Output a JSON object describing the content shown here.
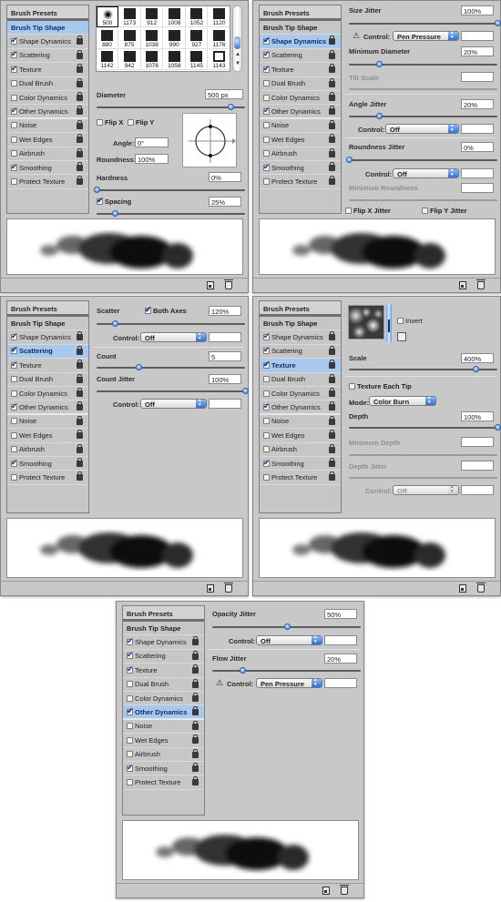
{
  "sidebar": {
    "presets": "Brush Presets",
    "tip_shape": "Brush Tip Shape",
    "items": [
      {
        "label": "Shape Dynamics",
        "checked": true
      },
      {
        "label": "Scattering",
        "checked": true
      },
      {
        "label": "Texture",
        "checked": true
      },
      {
        "label": "Dual Brush",
        "checked": false
      },
      {
        "label": "Color Dynamics",
        "checked": false
      },
      {
        "label": "Other Dynamics",
        "checked": true
      },
      {
        "label": "Noise",
        "checked": false
      },
      {
        "label": "Wet Edges",
        "checked": false
      },
      {
        "label": "Airbrush",
        "checked": false
      },
      {
        "label": "Smoothing",
        "checked": true
      },
      {
        "label": "Protect Texture",
        "checked": false
      }
    ]
  },
  "panels": [
    {
      "active_section": "Brush Tip Shape",
      "brush_tips": [
        "500",
        "1173",
        "912",
        "1008",
        "1052",
        "1120",
        "880",
        "875",
        "1038",
        "990",
        "927",
        "1176",
        "1142",
        "942",
        "1078",
        "1058",
        "1145",
        "1143"
      ],
      "selected_tip": "500",
      "diameter": {
        "label": "Diameter",
        "value": "500 px",
        "slider": 0.9
      },
      "flip_x": {
        "label": "Flip X",
        "checked": false
      },
      "flip_y": {
        "label": "Flip Y",
        "checked": false
      },
      "angle": {
        "label": "Angle:",
        "value": "0°"
      },
      "roundness": {
        "label": "Roundness:",
        "value": "100%"
      },
      "hardness": {
        "label": "Hardness",
        "value": "0%",
        "slider": 0.0
      },
      "spacing": {
        "label": "Spacing",
        "value": "25%",
        "checked": true,
        "slider": 0.12
      }
    },
    {
      "active_section": "Shape Dynamics",
      "size_jitter": {
        "label": "Size Jitter",
        "value": "100%",
        "slider": 1.0
      },
      "size_control": {
        "label": "Control:",
        "value": "Pen Pressure",
        "warning": true
      },
      "min_diameter": {
        "label": "Minimum Diameter",
        "value": "20%",
        "slider": 0.2
      },
      "tilt_scale": {
        "label": "Tilt Scale",
        "value": ""
      },
      "angle_jitter": {
        "label": "Angle Jitter",
        "value": "20%",
        "slider": 0.2
      },
      "angle_control": {
        "label": "Control:",
        "value": "Off"
      },
      "roundness_jitter": {
        "label": "Roundness Jitter",
        "value": "0%",
        "slider": 0.0
      },
      "roundness_control": {
        "label": "Control:",
        "value": "Off"
      },
      "min_roundness": {
        "label": "Minimum Roundness",
        "value": ""
      },
      "flip_x_jitter": {
        "label": "Flip X Jitter",
        "checked": false
      },
      "flip_y_jitter": {
        "label": "Flip Y Jitter",
        "checked": false
      }
    },
    {
      "active_section": "Scattering",
      "scatter": {
        "label": "Scatter",
        "value": "120%",
        "slider": 0.12
      },
      "both_axes": {
        "label": "Both Axes",
        "checked": true
      },
      "scatter_control": {
        "label": "Control:",
        "value": "Off"
      },
      "count": {
        "label": "Count",
        "value": "5",
        "slider": 0.28
      },
      "count_jitter": {
        "label": "Count Jitter",
        "value": "100%",
        "slider": 1.0
      },
      "count_control": {
        "label": "Control:",
        "value": "Off"
      }
    },
    {
      "active_section": "Texture",
      "invert": {
        "label": "Invert",
        "checked": false
      },
      "scale": {
        "label": "Scale",
        "value": "400%",
        "slider": 0.85
      },
      "texture_each_tip": {
        "label": "Texture Each Tip",
        "checked": false
      },
      "mode": {
        "label": "Mode:",
        "value": "Color Burn"
      },
      "depth": {
        "label": "Depth",
        "value": "100%",
        "slider": 1.0
      },
      "min_depth": {
        "label": "Minimum Depth",
        "value": ""
      },
      "depth_jitter": {
        "label": "Depth Jitter",
        "value": ""
      },
      "depth_control": {
        "label": "Control:",
        "value": "Off"
      }
    },
    {
      "active_section": "Other Dynamics",
      "opacity_jitter": {
        "label": "Opacity Jitter",
        "value": "50%",
        "slider": 0.5
      },
      "opacity_control": {
        "label": "Control:",
        "value": "Off"
      },
      "flow_jitter": {
        "label": "Flow Jitter",
        "value": "20%",
        "slider": 0.2
      },
      "flow_control": {
        "label": "Control:",
        "value": "Pen Pressure",
        "warning": true
      }
    }
  ],
  "icons": {
    "warning": "⚠",
    "lock": "lock-icon",
    "new_preset": "new-preset-icon",
    "trash": "trash-icon"
  }
}
